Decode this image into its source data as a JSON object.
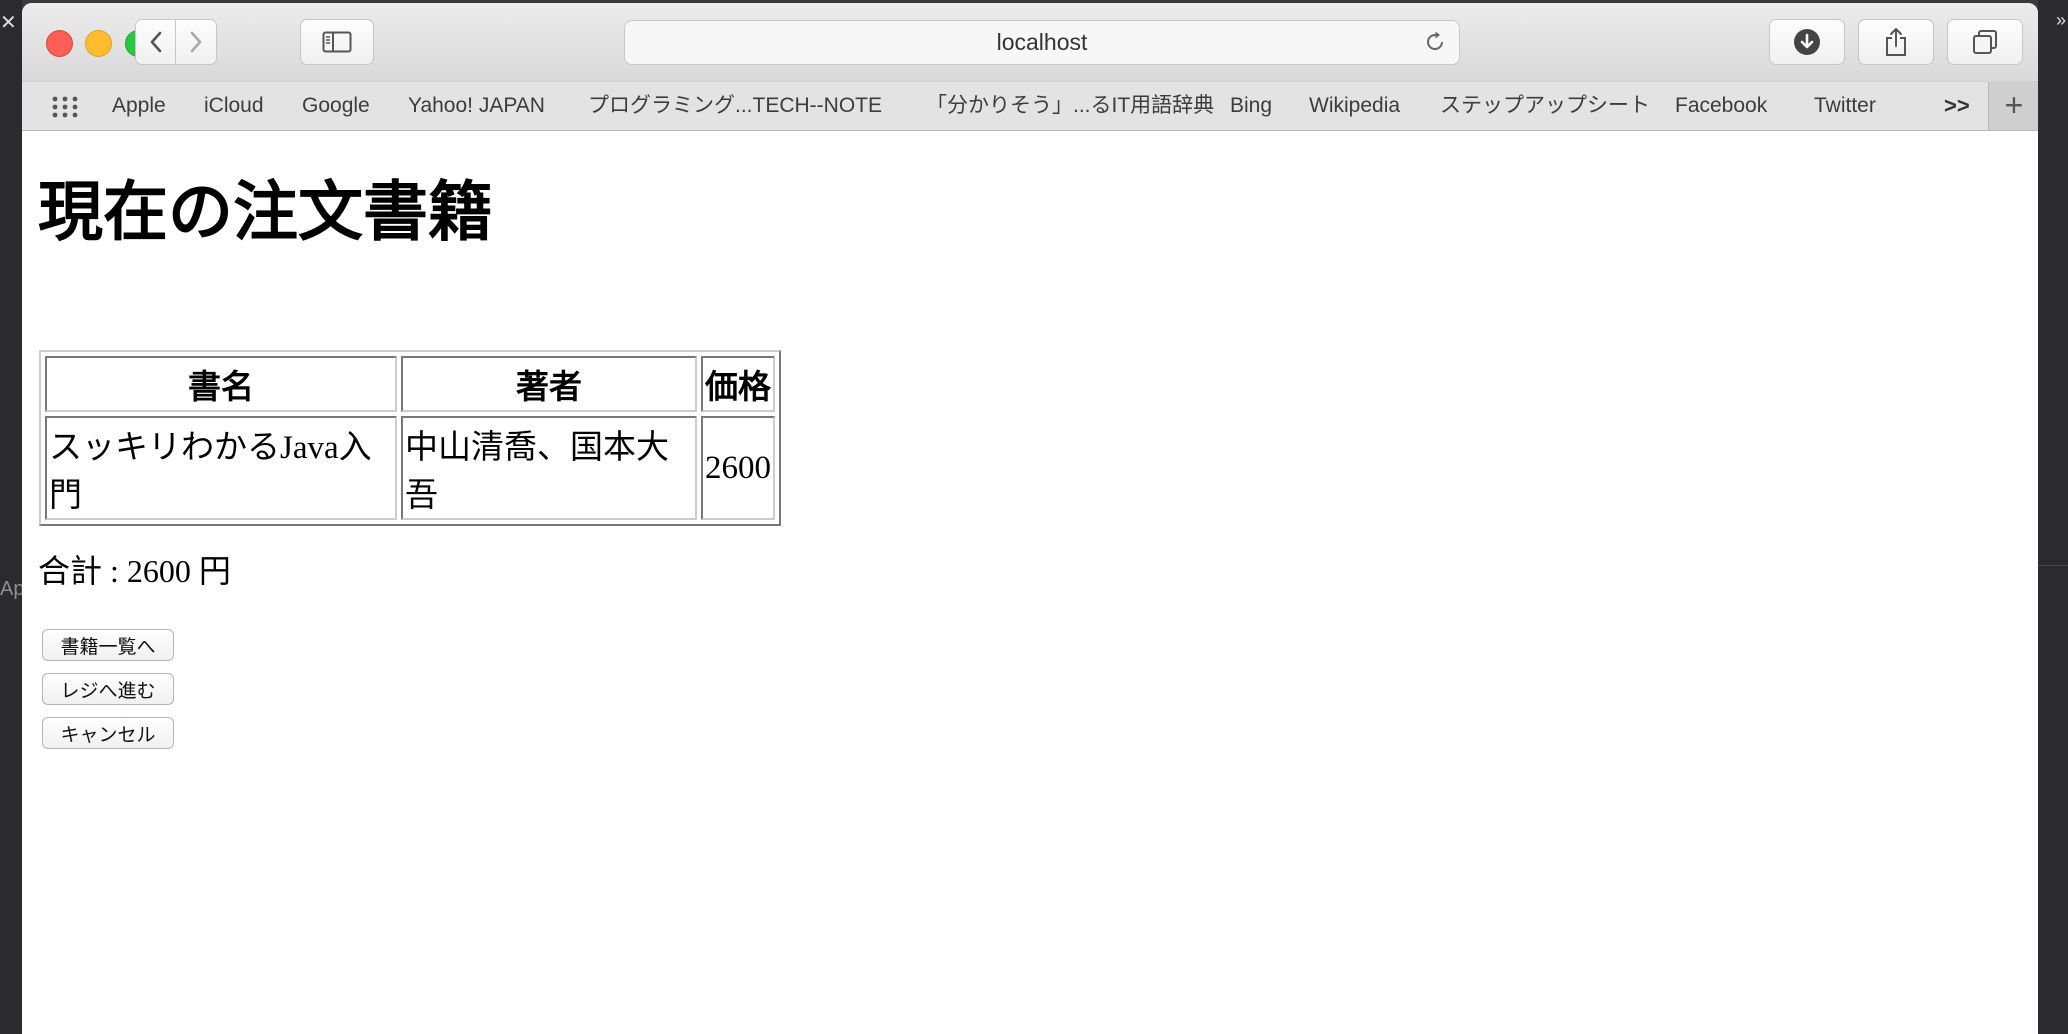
{
  "browser": {
    "url": "localhost",
    "bookmarks": [
      "Apple",
      "iCloud",
      "Google",
      "Yahoo! JAPAN",
      "プログラミング...TECH--NOTE",
      "「分かりそう」...るIT用語辞典",
      "Bing",
      "Wikipedia",
      "ステップアップシート",
      "Facebook",
      "Twitter"
    ],
    "more_label": ">>",
    "add_label": "+"
  },
  "page": {
    "title": "現在の注文書籍",
    "table": {
      "headers": [
        "書名",
        "著者",
        "価格"
      ],
      "rows": [
        [
          "スッキリわかるJava入門",
          "中山清喬、国本大吾",
          "2600"
        ]
      ]
    },
    "total_text": "合計 : 2600 円",
    "buttons": {
      "list": "書籍一覧へ",
      "checkout": "レジへ進む",
      "cancel": "キャンセル"
    }
  },
  "background": {
    "left_partial_text": "Ap",
    "close_glyph": "✕",
    "right_partial_text": "»"
  }
}
